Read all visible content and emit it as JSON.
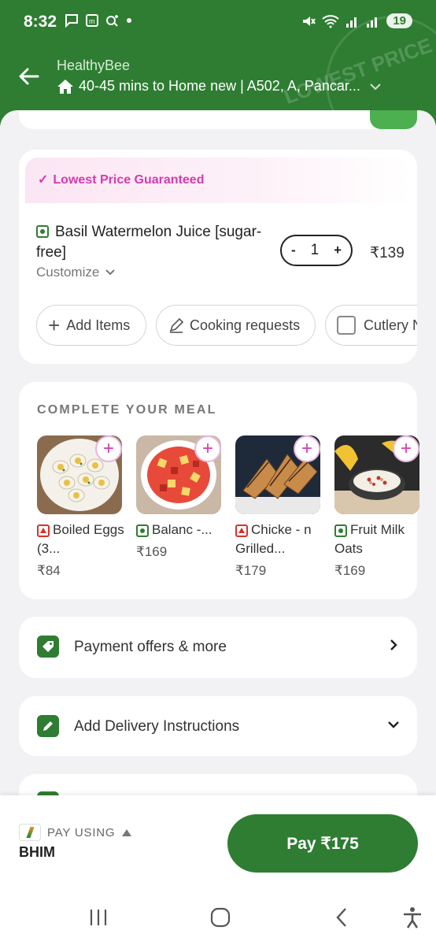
{
  "status_bar": {
    "time": "8:32",
    "battery": "19"
  },
  "header": {
    "store_name": "HealthyBee",
    "delivery_info": "40-45 mins to Home new | A502, A, Pancar...",
    "stamp_text": "LOWEST PRICE"
  },
  "cart": {
    "banner": "Lowest Price Guaranteed",
    "item": {
      "name": "Basil Watermelon Juice [sugar-free]",
      "customize_label": "Customize",
      "quantity": "1",
      "price": "₹139",
      "veg": true
    },
    "chips": {
      "add_items": "Add Items",
      "cooking_requests": "Cooking requests",
      "cutlery": "Cutlery N"
    }
  },
  "complete_meal": {
    "title": "COMPLETE YOUR MEAL",
    "items": [
      {
        "name": "Boiled Eggs (3...",
        "price": "₹84",
        "type": "nonveg"
      },
      {
        "name": "Balanc -...",
        "price": "₹169",
        "type": "veg"
      },
      {
        "name": "Chicke - n Grilled...",
        "price": "₹179",
        "type": "nonveg"
      },
      {
        "name": "Fruit Milk Oats",
        "price": "₹169",
        "type": "veg"
      }
    ]
  },
  "rows": {
    "payment_offers": "Payment offers & more",
    "delivery_instructions": "Add Delivery Instructions"
  },
  "footer": {
    "pay_using_label": "PAY USING",
    "pay_method": "BHIM",
    "pay_button": "Pay ₹175"
  },
  "colors": {
    "brand_green": "#2e7d32",
    "accent_pink": "#d63ab0"
  }
}
